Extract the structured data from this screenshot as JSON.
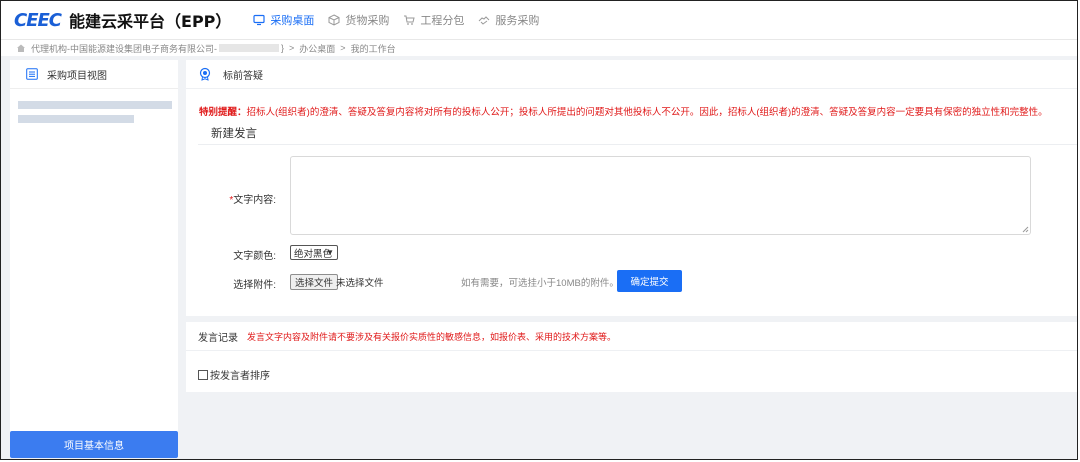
{
  "app": {
    "logo_text": "CEEC",
    "title": "能建云采平台（EPP）"
  },
  "nav": [
    {
      "label": "采购桌面",
      "icon": "monitor-icon",
      "active": true
    },
    {
      "label": "货物采购",
      "icon": "cube-icon",
      "active": false
    },
    {
      "label": "工程分包",
      "icon": "cart-icon",
      "active": false
    },
    {
      "label": "服务采购",
      "icon": "handshake-icon",
      "active": false
    }
  ],
  "breadcrumb": {
    "prefix": "代理机构-中国能源建设集团电子商务有限公司-",
    "suffix": "}",
    "items": [
      "办公桌面",
      "我的工作台"
    ]
  },
  "sidebar": {
    "header": "采购项目视图",
    "bottom_button": "项目基本信息"
  },
  "panel": {
    "title": "标前答疑",
    "notice_label": "特别提醒：",
    "notice_text": "招标人(组织者)的澄清、答疑及答复内容将对所有的投标人公开；投标人所提出的问题对其他投标人不公开。因此，招标人(组织者)的澄清、答疑及答复内容一定要具有保密的独立性和完整性。",
    "new_post_title": "新建发言",
    "form": {
      "text_label_required": "*",
      "text_label": "文字内容:",
      "color_label": "文字颜色:",
      "color_value": "绝对黑色",
      "attach_label": "选择附件:",
      "file_button": "选择文件",
      "file_status": "未选择文件",
      "file_hint": "如有需要，可选挂小于10MB的附件。",
      "submit": "确定提交"
    }
  },
  "records": {
    "title": "发言记录",
    "warning": "发言文字内容及附件请不要涉及有关报价实质性的敏感信息，如报价表、采用的技术方案等。",
    "sort_label": "按发言者排序"
  },
  "colors": {
    "primary": "#1a6ef5",
    "warning": "#e01a1a",
    "sidebar_button": "#3b7cf0",
    "background": "#f0f2f5"
  }
}
